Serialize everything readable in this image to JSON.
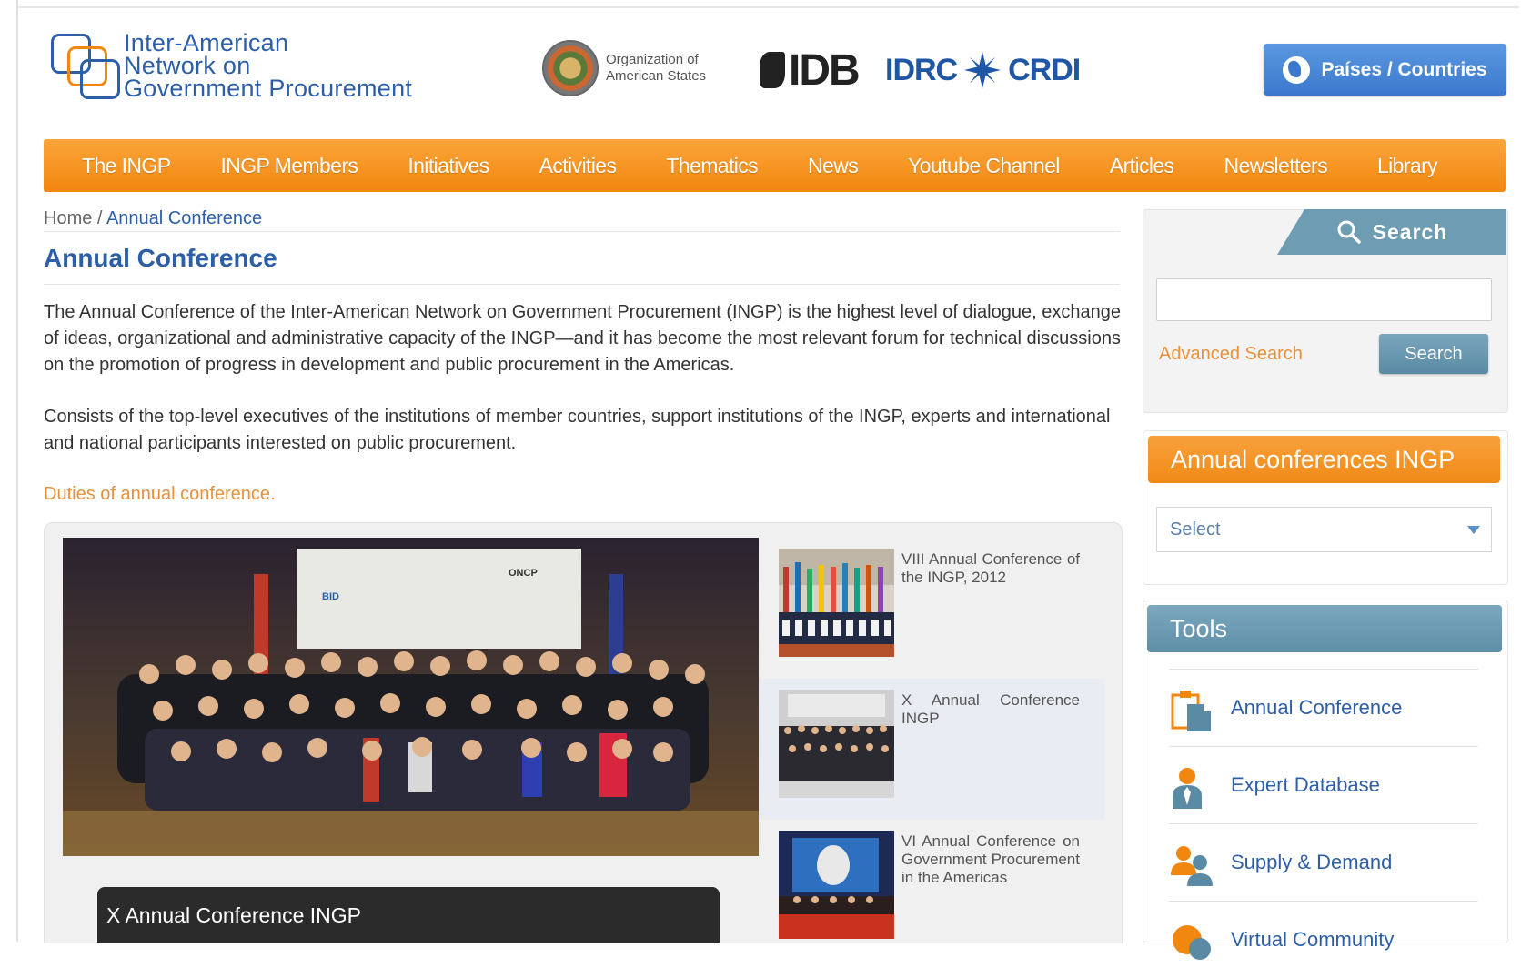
{
  "header": {
    "logo_lines": [
      "Inter-American",
      "Network on",
      "Government Procurement"
    ],
    "oas_lines": [
      "Organization of",
      "American States"
    ],
    "idb_text": "IDB",
    "idrc_left": "IDRC",
    "idrc_right": "CRDI",
    "countries_button": "Países / Countries"
  },
  "nav": {
    "items": [
      "The INGP",
      "INGP Members",
      "Initiatives",
      "Activities",
      "Thematics",
      "News",
      "Youtube Channel",
      "Articles",
      "Newsletters",
      "Library"
    ]
  },
  "breadcrumb": {
    "home": "Home",
    "separator": " / ",
    "current": "Annual Conference"
  },
  "main": {
    "title": "Annual Conference",
    "paragraph1": "The Annual Conference of the Inter-American Network on Government Procurement (INGP) is the highest level of dialogue, exchange of ideas, organizational and administrative capacity of the INGP—and it has become the most relevant forum for technical discussions on the promotion of progress in development and public procurement in the Americas.",
    "paragraph2": "Consists of the top-level executives of the institutions of member countries, support institutions of the INGP, experts and international and national participants interested on public procurement.",
    "duties_link": "Duties of annual conference."
  },
  "gallery": {
    "banner_labels": [
      "BID",
      "ONCP"
    ],
    "caption": "X Annual Conference INGP",
    "thumbs": [
      {
        "label": "VIII Annual Conference of the INGP, 2012"
      },
      {
        "label": "X Annual Conference INGP"
      },
      {
        "label": "VI Annual Conference on Government Procurement in the Americas"
      }
    ]
  },
  "sidebar": {
    "search_tab": "Search",
    "search_placeholder": "",
    "advanced_search": "Advanced Search",
    "search_button": "Search",
    "conferences_title": "Annual conferences INGP",
    "select_value": "Select",
    "tools_title": "Tools",
    "tools": [
      {
        "label": "Annual Conference",
        "icon": "document-icon"
      },
      {
        "label": "Expert Database",
        "icon": "expert-icon"
      },
      {
        "label": "Supply & Demand",
        "icon": "people-icon"
      },
      {
        "label": "Virtual Community",
        "icon": "community-icon"
      }
    ]
  },
  "colors": {
    "brand_blue": "#2d5fa8",
    "nav_orange": "#f2870f",
    "link_orange": "#e8903b",
    "sidebar_teal": "#6e9cb3",
    "button_blue": "#3b78cc"
  }
}
